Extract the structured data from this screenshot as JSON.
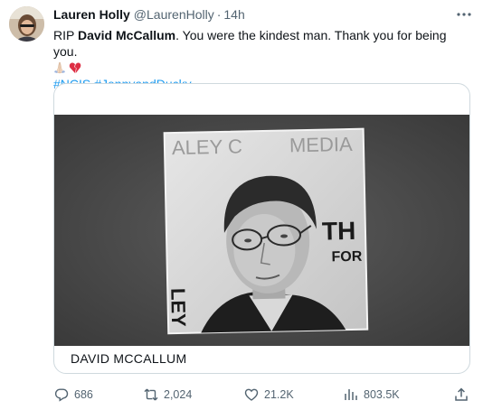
{
  "author": {
    "display_name": "Lauren Holly",
    "handle": "@LaurenHolly",
    "separator": "·",
    "time": "14h"
  },
  "tweet": {
    "text_prefix": "RIP ",
    "text_bold": "David McCallum",
    "text_suffix": ". You were the kindest man. Thank you for being you.",
    "emojis": [
      "folded-hands-icon",
      "broken-heart-icon"
    ],
    "hashtags": [
      "#NCIS",
      "#JennyandDucky"
    ]
  },
  "card": {
    "label": "DAVID MCCALLUM",
    "image_description_icon": "portrait-photo"
  },
  "actions": {
    "replies": "686",
    "retweets": "2,024",
    "likes": "21.2K",
    "views": "803.5K"
  },
  "colors": {
    "link": "#1d9bf0",
    "secondary_text": "#536471",
    "border": "#cfd9de",
    "primary_text": "#0f1419"
  }
}
